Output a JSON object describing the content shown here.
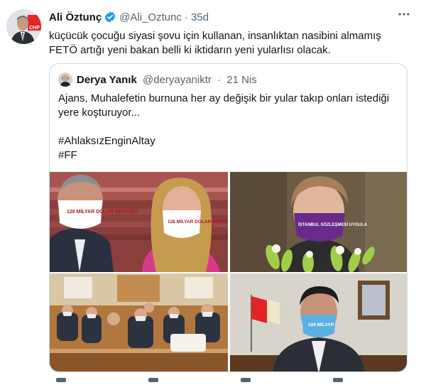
{
  "tweet": {
    "author_name": "Ali Öztunç",
    "author_handle": "@Ali_Oztunc",
    "separator": "·",
    "time": "35d",
    "verified_icon": "verified-badge-icon",
    "text": "küçücük çocuğu siyasi şovu için kullanan, insanlıktan nasibini almamış FETÖ artığı yeni bakan belli ki iktidarın yeni yularlısı olacak.",
    "avatar_badge": "CHP"
  },
  "quoted_tweet": {
    "author_name": "Derya Yanık",
    "author_handle": "@deryayaniktr",
    "separator": "·",
    "time": "21 Nis",
    "text_line1": "Ajans, Muhalefetin burnuna her ay değişik bir yular takıp onları istediği yere koşturuyor...",
    "hashtag1": "#AhlaksızEnginAltay",
    "hashtag2": "#FF"
  },
  "media": {
    "mask1_text": "128 MİLYAR DOLAR NEREDE?",
    "mask2_text": "128 MİLYAR DOLAR NEREDE",
    "mask3_text": "İSTANBUL SÖZLEŞMESİ UYGULA",
    "mask4_text": "128 MİLYAR"
  },
  "colors": {
    "text": "#0f1419",
    "secondary": "#536471",
    "verified": "#1d9bf0",
    "border": "#cfd9de"
  }
}
